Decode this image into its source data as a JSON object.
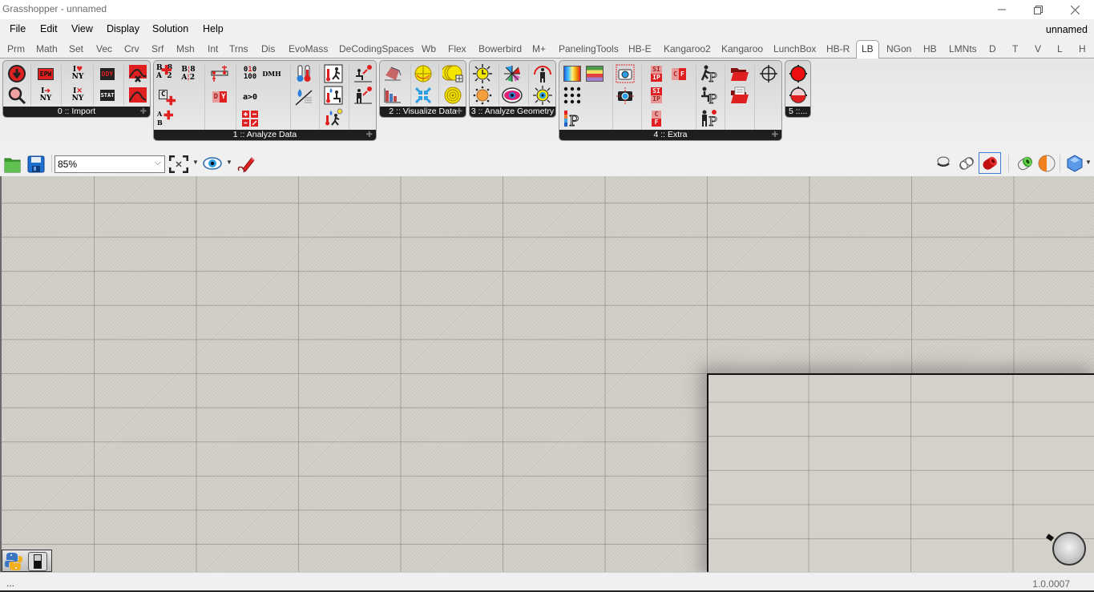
{
  "window": {
    "title": "Grasshopper - unnamed",
    "minimize_icon": "minimize-icon",
    "maximize_icon": "restore-icon",
    "close_icon": "close-icon"
  },
  "menubar": {
    "items": [
      "File",
      "Edit",
      "View",
      "Display",
      "Solution",
      "Help"
    ],
    "document_name": "unnamed"
  },
  "tabs": {
    "items": [
      "Prm",
      "Math",
      "Set",
      "Vec",
      "Crv",
      "Srf",
      "Msh",
      "Int",
      "Trns",
      "Dis",
      "EvoMass",
      "DeCodingSpaces",
      "Wb",
      "Flex",
      "Bowerbird",
      "M+",
      "PanelingTools",
      "HB-E",
      "Kangaroo2",
      "Kangaroo",
      "LunchBox",
      "HB-R",
      "LB",
      "NGon",
      "HB",
      "LMNts",
      "D",
      "T",
      "V",
      "L",
      "H"
    ],
    "active": "LB"
  },
  "ribbon": {
    "panels": [
      {
        "label": "0 :: Import"
      },
      {
        "label": "1 :: Analyze Data"
      },
      {
        "label": "2 :: Visualize Data"
      },
      {
        "label": "3 :: Analyze Geometry"
      },
      {
        "label": "4 :: Extra"
      },
      {
        "label": "5 ::..."
      }
    ],
    "import_icons": {
      "epw": "EPW",
      "ddy": "DDY",
      "stat": "STAT",
      "iny_a": "I",
      "iny_b": "NY"
    },
    "analyze_icons": {
      "b8": "B 8",
      "a2": "A 2",
      "c": "C",
      "ab": "A B",
      "bin": "010\n100",
      "dmh": "DMH",
      "agt0": "a>0",
      "dy": "D Y"
    },
    "extra_icons": {
      "si": "SI",
      "ip": "IP",
      "c": "C",
      "f": "F"
    }
  },
  "canvas_toolbar": {
    "zoom_value": "85%",
    "open_icon": "folder-open-icon",
    "save_icon": "save-icon",
    "zoom_extents_icon": "zoom-extents-icon",
    "preview_icon": "eye-icon",
    "sketch_icon": "pen-sketch-icon",
    "right_icons": [
      "preview-off-icon",
      "wireframe-preview-icon",
      "shaded-preview-icon",
      "selected-preview-icon",
      "material-preview-icon",
      "mesh-quality-icon"
    ]
  },
  "status": {
    "left": "...",
    "version": "1.0.0007"
  }
}
